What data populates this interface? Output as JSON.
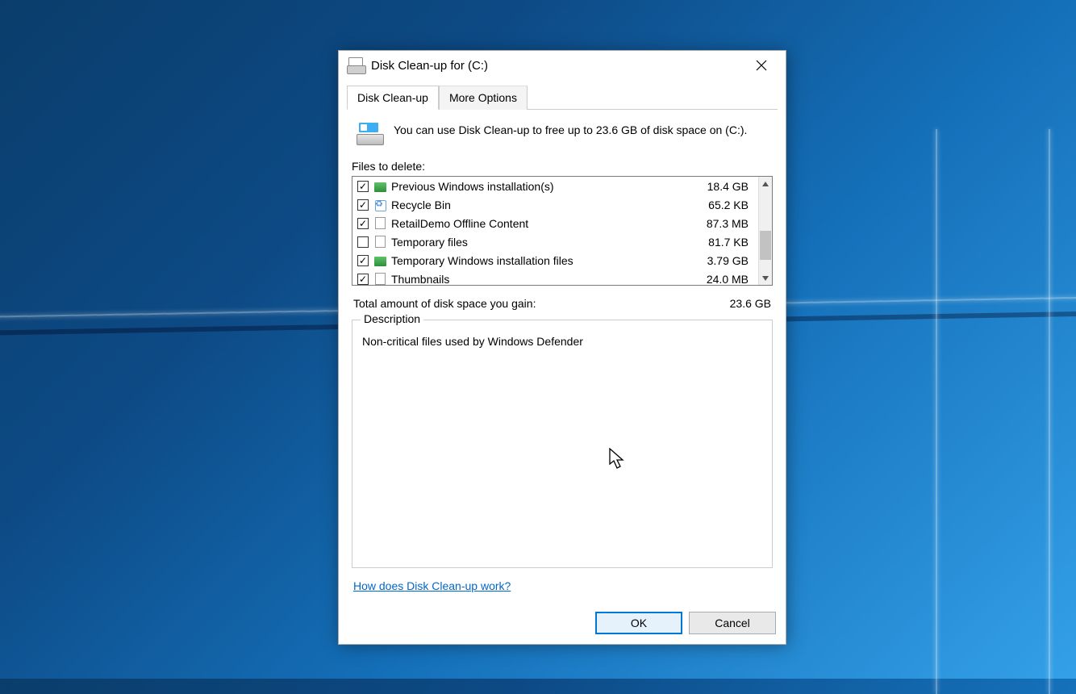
{
  "window": {
    "title": "Disk Clean-up for  (C:)"
  },
  "tabs": {
    "primary": "Disk Clean-up",
    "secondary": "More Options"
  },
  "intro": "You can use Disk Clean-up to free up to 23.6 GB of disk space on  (C:).",
  "files_label": "Files to delete:",
  "items": [
    {
      "checked": true,
      "icon": "folder",
      "name": "Previous Windows installation(s)",
      "size": "18.4 GB"
    },
    {
      "checked": true,
      "icon": "recycle",
      "name": "Recycle Bin",
      "size": "65.2 KB"
    },
    {
      "checked": true,
      "icon": "file",
      "name": "RetailDemo Offline Content",
      "size": "87.3 MB"
    },
    {
      "checked": false,
      "icon": "file",
      "name": "Temporary files",
      "size": "81.7 KB"
    },
    {
      "checked": true,
      "icon": "folder",
      "name": "Temporary Windows installation files",
      "size": "3.79 GB"
    },
    {
      "checked": true,
      "icon": "file",
      "name": "Thumbnails",
      "size": "24.0 MB"
    }
  ],
  "total": {
    "label": "Total amount of disk space you gain:",
    "value": "23.6 GB"
  },
  "description": {
    "legend": "Description",
    "text": "Non-critical files used by Windows Defender"
  },
  "help_link": "How does Disk Clean-up work?",
  "buttons": {
    "ok": "OK",
    "cancel": "Cancel"
  }
}
